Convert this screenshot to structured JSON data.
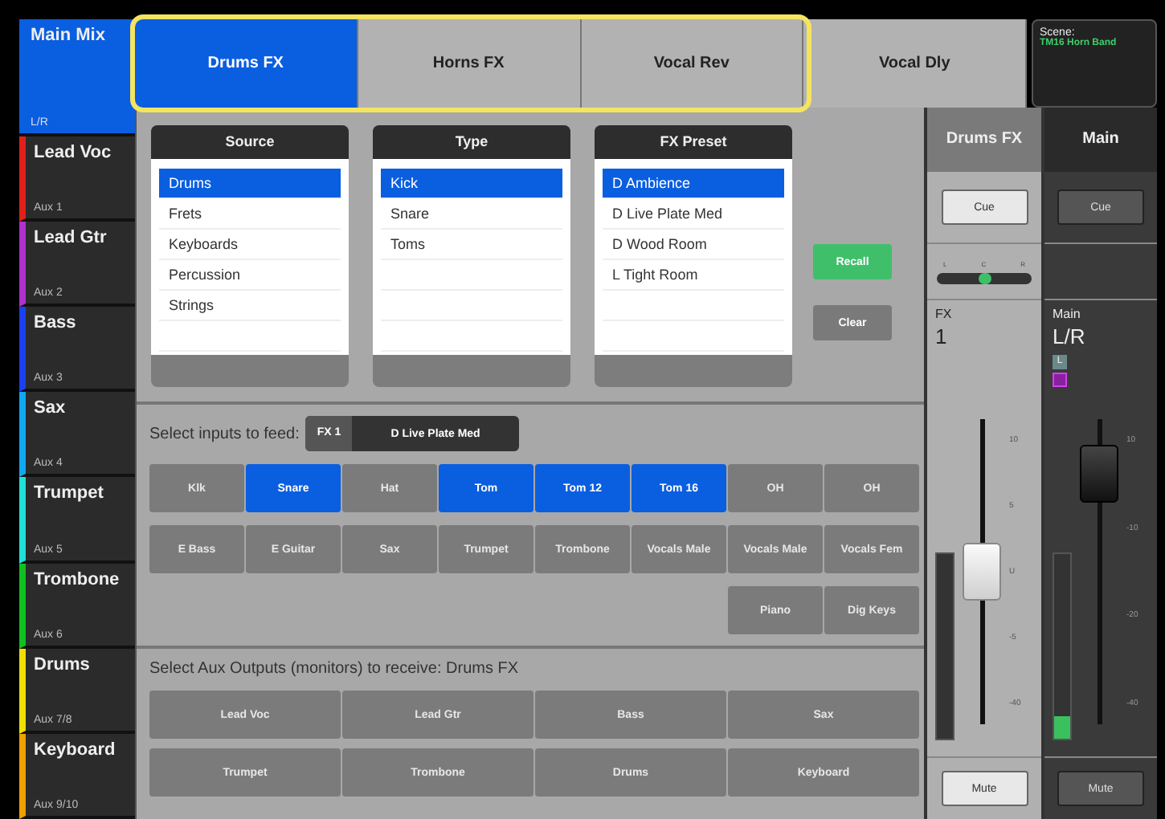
{
  "sidebar": {
    "items": [
      {
        "name": "Main Mix",
        "sub": "L/R",
        "color": "#0a5ee0",
        "selected": true
      },
      {
        "name": "Lead Voc",
        "sub": "Aux 1",
        "color": "#e0201a",
        "selected": false
      },
      {
        "name": "Lead Gtr",
        "sub": "Aux 2",
        "color": "#b030d0",
        "selected": false
      },
      {
        "name": "Bass",
        "sub": "Aux 3",
        "color": "#1a40f0",
        "selected": false
      },
      {
        "name": "Sax",
        "sub": "Aux 4",
        "color": "#10a8f0",
        "selected": false
      },
      {
        "name": "Trumpet",
        "sub": "Aux 5",
        "color": "#20e0d8",
        "selected": false
      },
      {
        "name": "Trombone",
        "sub": "Aux 6",
        "color": "#10c020",
        "selected": false
      },
      {
        "name": "Drums",
        "sub": "Aux 7/8",
        "color": "#f0e000",
        "selected": false
      },
      {
        "name": "Keyboard",
        "sub": "Aux 9/10",
        "color": "#f0a000",
        "selected": false
      }
    ]
  },
  "tabs": [
    {
      "label": "Drums FX",
      "selected": true
    },
    {
      "label": "Horns FX",
      "selected": false
    },
    {
      "label": "Vocal Rev",
      "selected": false
    },
    {
      "label": "Vocal Dly",
      "selected": false
    }
  ],
  "scene": {
    "label": "Scene:",
    "name": "TM16 Horn Band"
  },
  "lists": [
    {
      "title": "Source",
      "items": [
        {
          "label": "Drums",
          "selected": true
        },
        {
          "label": "Frets",
          "selected": false
        },
        {
          "label": "Keyboards",
          "selected": false
        },
        {
          "label": "Percussion",
          "selected": false
        },
        {
          "label": "Strings",
          "selected": false
        }
      ]
    },
    {
      "title": "Type",
      "items": [
        {
          "label": "Kick",
          "selected": true
        },
        {
          "label": "Snare",
          "selected": false
        },
        {
          "label": "Toms",
          "selected": false
        }
      ]
    },
    {
      "title": "FX Preset",
      "items": [
        {
          "label": "D Ambience",
          "selected": true
        },
        {
          "label": "D Live Plate Med",
          "selected": false
        },
        {
          "label": "D Wood Room",
          "selected": false
        },
        {
          "label": "L Tight Room",
          "selected": false
        }
      ]
    }
  ],
  "actions": [
    "Recall",
    "Clear"
  ],
  "feed": {
    "label": "Select inputs to feed:",
    "fx": "FX 1",
    "preset": "D Live Plate Med"
  },
  "inputs": [
    [
      {
        "label": "Klk",
        "selected": false
      },
      {
        "label": "Snare",
        "selected": true
      },
      {
        "label": "Hat",
        "selected": false
      },
      {
        "label": "Tom",
        "selected": true
      },
      {
        "label": "Tom 12",
        "selected": true
      },
      {
        "label": "Tom 16",
        "selected": true
      },
      {
        "label": "OH",
        "selected": false
      },
      {
        "label": "OH",
        "selected": false
      }
    ],
    [
      {
        "label": "E Bass",
        "selected": false
      },
      {
        "label": "E Guitar",
        "selected": false
      },
      {
        "label": "Sax",
        "selected": false
      },
      {
        "label": "Trumpet",
        "selected": false
      },
      {
        "label": "Trombone",
        "selected": false
      },
      {
        "label": "Vocals Male",
        "selected": false
      },
      {
        "label": "Vocals Male",
        "selected": false
      },
      {
        "label": "Vocals Fem",
        "selected": false
      }
    ],
    [
      {
        "label": "Piano",
        "selected": false
      },
      {
        "label": "Dig Keys",
        "selected": false
      }
    ]
  ],
  "aux": {
    "label": "Select Aux Outputs (monitors) to receive:  Drums FX",
    "rows": [
      [
        {
          "label": "Lead Voc",
          "selected": false
        },
        {
          "label": "Lead Gtr",
          "selected": false
        },
        {
          "label": "Bass",
          "selected": false
        },
        {
          "label": "Sax",
          "selected": false
        }
      ],
      [
        {
          "label": "Trumpet",
          "selected": false
        },
        {
          "label": "Trombone",
          "selected": false
        },
        {
          "label": "Drums",
          "selected": false
        },
        {
          "label": "Keyboard",
          "selected": false
        }
      ]
    ]
  },
  "strips": [
    {
      "kind": "fx",
      "title": "Drums FX",
      "cue": "Cue",
      "pan_labels": [
        "L",
        "C",
        "R"
      ],
      "pan": {
        "level": 0.5
      },
      "type": "FX",
      "number": "1",
      "scale": [
        "10",
        "5",
        "U",
        "-5",
        "-40"
      ],
      "fader": {
        "level": 0.5
      },
      "mute": "Mute"
    },
    {
      "kind": "main",
      "title": "Main",
      "cue": "Cue",
      "type": "Main",
      "number": "L/R",
      "badges": [
        "L"
      ],
      "scale": [
        "10",
        "-10",
        "-20",
        "-40"
      ],
      "fader": {
        "level": 0.82
      },
      "meter": {
        "level": 0.12
      },
      "mute": "Mute"
    }
  ]
}
